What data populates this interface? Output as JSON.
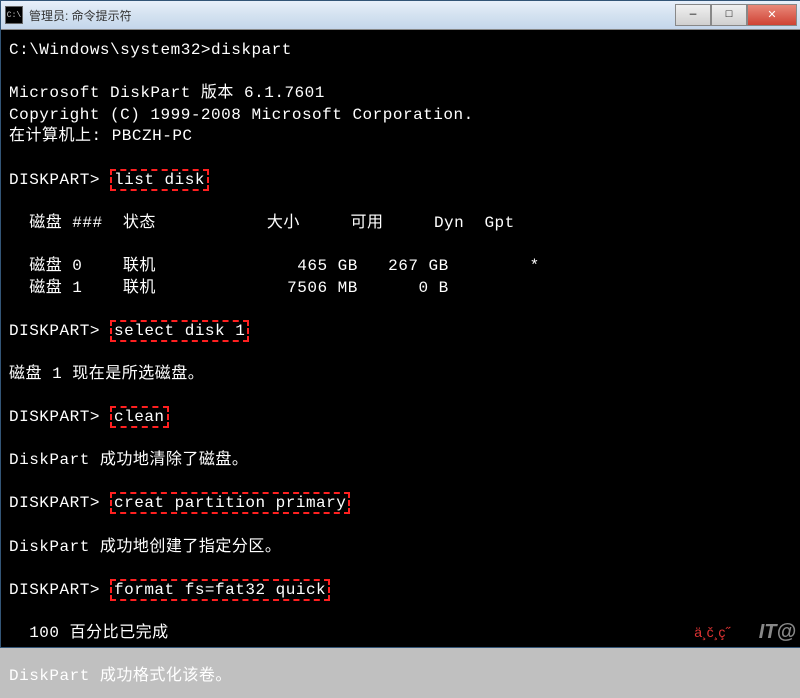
{
  "window": {
    "icon_label": "C:\\",
    "title": "管理员: 命令提示符"
  },
  "buttons": {
    "min": "—",
    "max": "□",
    "close": "✕"
  },
  "term": {
    "line1": "C:\\Windows\\system32>diskpart",
    "blank": "",
    "ver": "Microsoft DiskPart 版本 6.1.7601",
    "copy": "Copyright (C) 1999-2008 Microsoft Corporation.",
    "host": "在计算机上: PBCZH-PC",
    "p1": "DISKPART> ",
    "cmd1": "list disk",
    "header": "  磁盘 ###  状态           大小     可用     Dyn  Gpt",
    "divider": "  --------  -------------  -------  -------  ---  ---",
    "row0": "  磁盘 0    联机              465 GB   267 GB        *",
    "row1": "  磁盘 1    联机             7506 MB      0 B",
    "p2": "DISKPART> ",
    "cmd2": "select disk 1",
    "msg2": "磁盘 1 现在是所选磁盘。",
    "p3": "DISKPART> ",
    "cmd3": "clean",
    "msg3": "DiskPart 成功地清除了磁盘。",
    "p4": "DISKPART> ",
    "cmd4": "creat partition primary",
    "msg4": "DiskPart 成功地创建了指定分区。",
    "p5": "DISKPART> ",
    "cmd5": "format fs=fat32 quick",
    "prog": "  100 百分比已完成",
    "msg5": "DiskPart 成功格式化该卷。"
  },
  "watermark": {
    "w1": "ä¸č¸ç˝",
    "w2": "IT@"
  }
}
